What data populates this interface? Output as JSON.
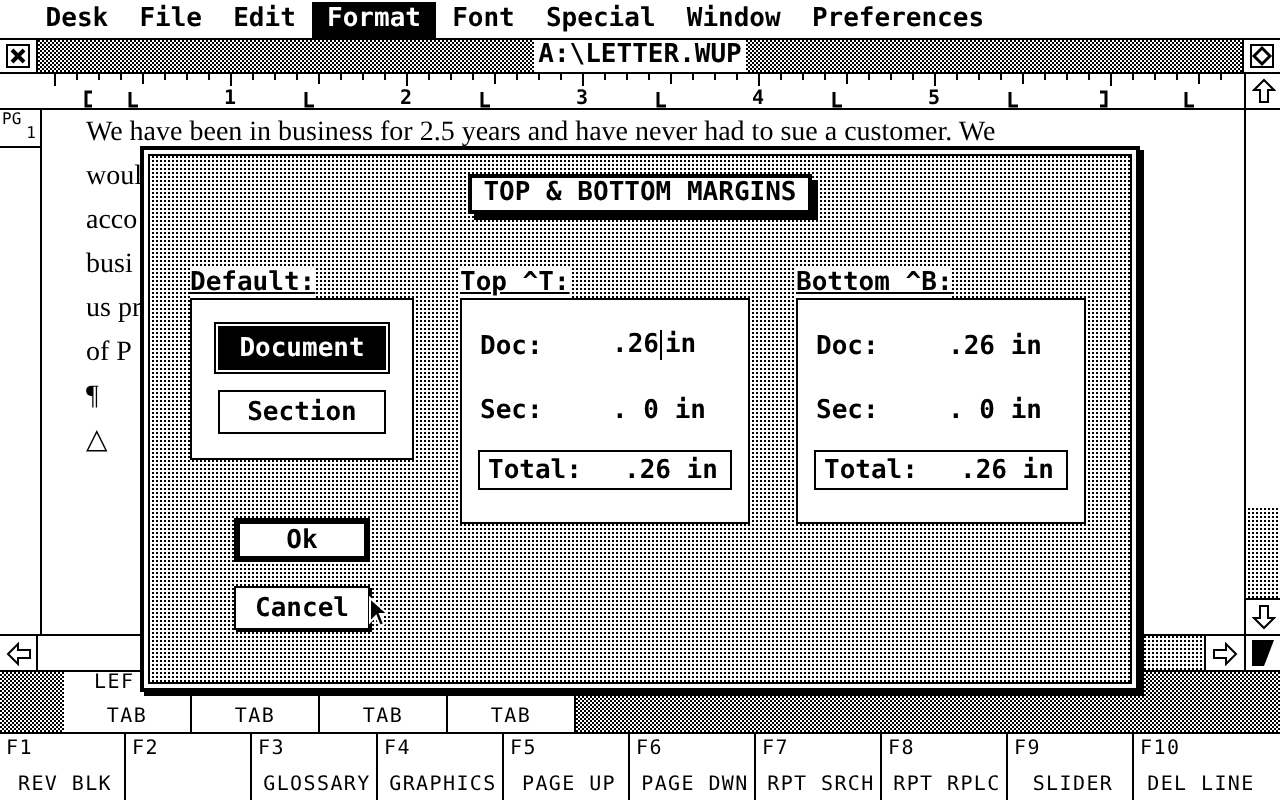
{
  "menu_bar": {
    "items": [
      {
        "label": "Desk",
        "selected": false
      },
      {
        "label": "File",
        "selected": false
      },
      {
        "label": "Edit",
        "selected": false
      },
      {
        "label": "Format",
        "selected": true
      },
      {
        "label": "Font",
        "selected": false
      },
      {
        "label": "Special",
        "selected": false
      },
      {
        "label": "Window",
        "selected": false
      },
      {
        "label": "Preferences",
        "selected": false
      }
    ]
  },
  "window": {
    "title": "A:\\LETTER.WUP",
    "ruler_numbers": [
      "1",
      "2",
      "3",
      "4",
      "5"
    ],
    "page_label": "PG",
    "page_number": "1",
    "lines": [
      "We have been in business for 2.5 years and have never had to sue a customer.  We",
      "woul",
      "acco",
      "busi",
      "us pr",
      "of P",
      "¶",
      "△"
    ]
  },
  "dialog": {
    "title": "TOP & BOTTOM MARGINS",
    "default_label": "Default:",
    "options": [
      {
        "label": "Document",
        "selected": true
      },
      {
        "label": "Section",
        "selected": false
      }
    ],
    "margins": [
      {
        "label": "Top ^T:",
        "doc_label": "Doc:",
        "doc_value": ".26",
        "doc_unit": "in",
        "cursor": true,
        "sec_label": "Sec:",
        "sec_value": ". 0",
        "sec_unit": "in",
        "total_label": "Total:",
        "total_value": ".26 in"
      },
      {
        "label": "Bottom ^B:",
        "doc_label": "Doc:",
        "doc_value": ".26",
        "doc_unit": "in",
        "cursor": false,
        "sec_label": "Sec:",
        "sec_value": ". 0",
        "sec_unit": "in",
        "total_label": "Total:",
        "total_value": ".26 in"
      }
    ],
    "buttons": [
      {
        "label": "Ok",
        "default": true
      },
      {
        "label": "Cancel",
        "default": false
      }
    ]
  },
  "tab_keys": [
    {
      "top": "LEF",
      "label": "TAB"
    },
    {
      "label": "TAB"
    },
    {
      "label": "TAB"
    },
    {
      "label": "TAB"
    }
  ],
  "function_keys": [
    {
      "key": "F1",
      "label": "REV BLK"
    },
    {
      "key": "F2"
    },
    {
      "key": "F3",
      "label": "GLOSSARY"
    },
    {
      "key": "F4",
      "label": "GRAPHICS"
    },
    {
      "key": "F5",
      "label": "PAGE UP"
    },
    {
      "key": "F6",
      "label": "PAGE DWN"
    },
    {
      "key": "F7",
      "label": "RPT SRCH"
    },
    {
      "key": "F8",
      "label": "RPT RPLC"
    },
    {
      "key": "F9",
      "label": "SLIDER"
    },
    {
      "key": "F10",
      "label": "DEL LINE"
    }
  ]
}
